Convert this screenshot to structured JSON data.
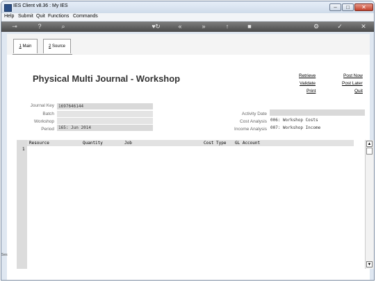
{
  "window": {
    "title": "IES Client v8.36 : My IES"
  },
  "menu": [
    "Help",
    "Submit",
    "Quit",
    "Functions",
    "Commands"
  ],
  "tabs": [
    {
      "key": "1",
      "label": " Main"
    },
    {
      "key": "2",
      "label": " Source"
    }
  ],
  "page": {
    "title": "Physical Multi Journal - Workshop"
  },
  "actions": {
    "retrieve": "Retrieve",
    "validate": "Validate",
    "print": "Print",
    "post_now": "Post Now",
    "post_later": "Post Later",
    "quit": "Quit"
  },
  "form": {
    "journal_key_label": "Journal Key",
    "journal_key_value": "1697646144",
    "batch_label": "Batch",
    "batch_value": "",
    "workshop_label": "Workshop",
    "workshop_value": "",
    "period_label": "Period",
    "period_value": "165: Jun 2014",
    "activity_date_label": "Activity Date",
    "activity_date_value": "",
    "cost_analysis_label": "Cost Analysis",
    "cost_analysis_value": "006: Workshop Costs",
    "income_analysis_label": "Income Analysis",
    "income_analysis_value": "007: Workshop Income"
  },
  "grid": {
    "columns": [
      "Resource",
      "Quantity",
      "Job",
      "Cost Type",
      "GL Account"
    ],
    "row_number": "1"
  },
  "status": {
    "left_text": "Ses"
  }
}
